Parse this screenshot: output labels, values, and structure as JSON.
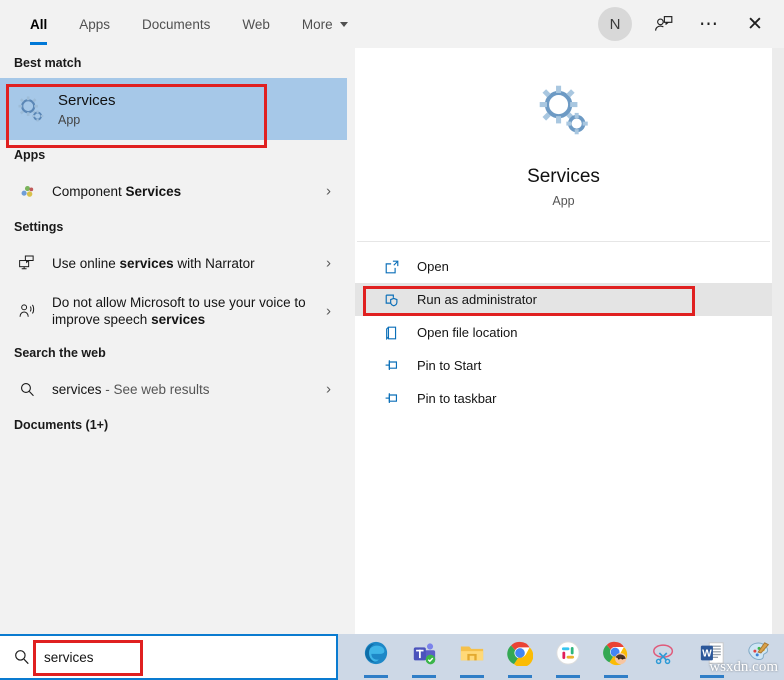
{
  "header": {
    "tabs": [
      {
        "label": "All",
        "active": true
      },
      {
        "label": "Apps",
        "active": false
      },
      {
        "label": "Documents",
        "active": false
      },
      {
        "label": "Web",
        "active": false
      },
      {
        "label": "More",
        "active": false,
        "caret": true
      }
    ],
    "avatar_initial": "N",
    "feedback_icon": "person-share-icon",
    "more_icon": "ellipsis-icon",
    "close_icon": "close-icon",
    "accent_color": "#0078d7"
  },
  "left": {
    "best_match_heading": "Best match",
    "best_match": {
      "title": "Services",
      "subtitle": "App",
      "icon": "services-gears-icon",
      "selected_color": "#a6c8e8"
    },
    "apps_heading": "Apps",
    "apps": [
      {
        "label_plain": "Component ",
        "label_bold": "Services",
        "icon": "component-services-icon",
        "chevron": "›"
      }
    ],
    "settings_heading": "Settings",
    "settings": [
      {
        "icon": "narrator-monitor-icon",
        "chevron": "›",
        "parts": [
          {
            "text": "Use online ",
            "bold": false
          },
          {
            "text": "services",
            "bold": true
          },
          {
            "text": " with Narrator",
            "bold": false
          }
        ]
      },
      {
        "icon": "speech-person-icon",
        "chevron": "›",
        "parts": [
          {
            "text": "Do not allow Microsoft to use your voice to improve speech ",
            "bold": false
          },
          {
            "text": "services",
            "bold": true
          }
        ]
      }
    ],
    "web_heading": "Search the web",
    "web": [
      {
        "query": "services",
        "suffix": " - See web results",
        "icon": "search-icon",
        "chevron": "›"
      }
    ],
    "documents_heading": "Documents (1+)"
  },
  "preview": {
    "app_icon": "services-gears-icon",
    "title": "Services",
    "subtitle": "App",
    "actions": [
      {
        "label": "Open",
        "icon": "open-window-icon",
        "hovered": false
      },
      {
        "label": "Run as administrator",
        "icon": "shield-admin-icon",
        "hovered": true
      },
      {
        "label": "Open file location",
        "icon": "folder-location-icon",
        "hovered": false
      },
      {
        "label": "Pin to Start",
        "icon": "pin-icon",
        "hovered": false
      },
      {
        "label": "Pin to taskbar",
        "icon": "pin-icon",
        "hovered": false
      }
    ]
  },
  "annotations": {
    "color": "#e02020",
    "items": [
      "best-match-highlight",
      "run-as-administrator-highlight",
      "search-query-highlight"
    ]
  },
  "taskbar": {
    "search": {
      "value": "services",
      "icon": "search-icon",
      "border_color": "#0a7bd0"
    },
    "apps": [
      {
        "name": "microsoft-edge",
        "running": true
      },
      {
        "name": "microsoft-teams",
        "running": true
      },
      {
        "name": "file-explorer",
        "running": true
      },
      {
        "name": "google-chrome",
        "running": true
      },
      {
        "name": "slack",
        "running": true
      },
      {
        "name": "chrome-profile",
        "running": true
      },
      {
        "name": "snipping-tool",
        "running": false
      },
      {
        "name": "microsoft-word",
        "running": true
      },
      {
        "name": "paint",
        "running": false
      }
    ],
    "watermark": "wsxdn.com"
  }
}
